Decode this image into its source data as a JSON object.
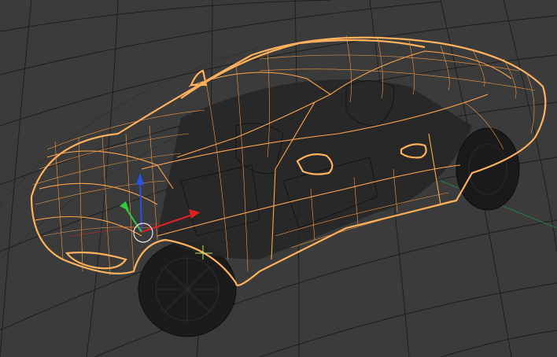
{
  "viewport": {
    "background": "#3b3b3b",
    "grid_color": "#1c1c1c",
    "wireframe_color": "#ffa64d",
    "selected_object": "car-body-wireframe"
  },
  "gizmo": {
    "axis_x_color": "#e02020",
    "axis_y_color": "#2ecc40",
    "axis_z_color": "#2a52e0",
    "icons": [
      "move-gizmo-icon",
      "rotate-ring-icon"
    ]
  },
  "world_axes": {
    "x_color": "#b03030",
    "y_color": "#2e8b3e"
  }
}
